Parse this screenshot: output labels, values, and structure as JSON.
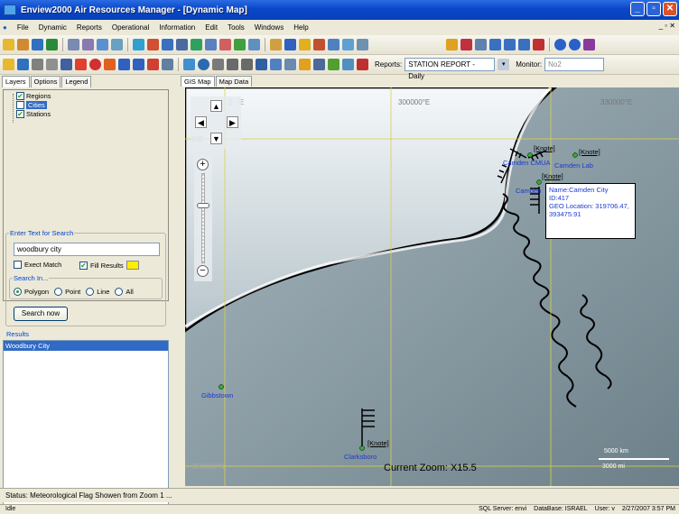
{
  "window": {
    "title": "Enview2000 Air Resources Manager - [Dynamic Map]"
  },
  "menu": [
    "File",
    "Dynamic",
    "Reports",
    "Operational",
    "Information",
    "Edit",
    "Tools",
    "Windows",
    "Help"
  ],
  "toolbar3": {
    "reports_label": "Reports:",
    "reports_value": "STATION REPORT - Daily",
    "monitor_label": "Monitor:",
    "monitor_value": "No2"
  },
  "left_tabs": [
    "Layers",
    "Options",
    "Legend"
  ],
  "layers": [
    {
      "label": "Regions",
      "checked": true
    },
    {
      "label": "Cities",
      "checked": false
    },
    {
      "label": "Stations",
      "checked": true
    }
  ],
  "search": {
    "legend": "Enter Text for Search",
    "value": "woodbury city",
    "exact_match": "Exect Match",
    "fill_results": "Fill Results",
    "search_in_legend": "Search In...",
    "options": [
      "Polygon",
      "Point",
      "Line",
      "All"
    ],
    "button": "Search now"
  },
  "results": {
    "legend": "Results",
    "items": [
      "Woodbury City"
    ]
  },
  "map_tabs": [
    "GIS Map",
    "Map Data"
  ],
  "map": {
    "coords": {
      "left_top": "2",
      "ne_fragment": "E",
      "mid": "300000°E",
      "right": "330000°E",
      "y_label_top": "400",
      "y_label_bottom": "350000°N"
    },
    "labels": {
      "camden_cmua": "Camden CMUA",
      "camden_lab": "Camden Lab",
      "camden": "Camden",
      "gibbstown": "Gibbstown",
      "clarksboro": "Clarksboro",
      "knote": "[Knote]"
    },
    "tooltip": [
      "Name:Camden City",
      "ID:417",
      "GEO Location: 319706.47,",
      "393475.91"
    ],
    "zoom": "Current Zoom: X15.5",
    "scale": {
      "km": "5000 km",
      "mi": "3000 mi"
    }
  },
  "status": "Status:  Meteorological Flag Showen from Zoom 1 ...",
  "bottom": {
    "idle": "Idle",
    "sql": "SQL Server: envi",
    "db": "DataBase: ISRAEL",
    "user": "User: v",
    "time": "2/27/2007 3:57 PM"
  }
}
